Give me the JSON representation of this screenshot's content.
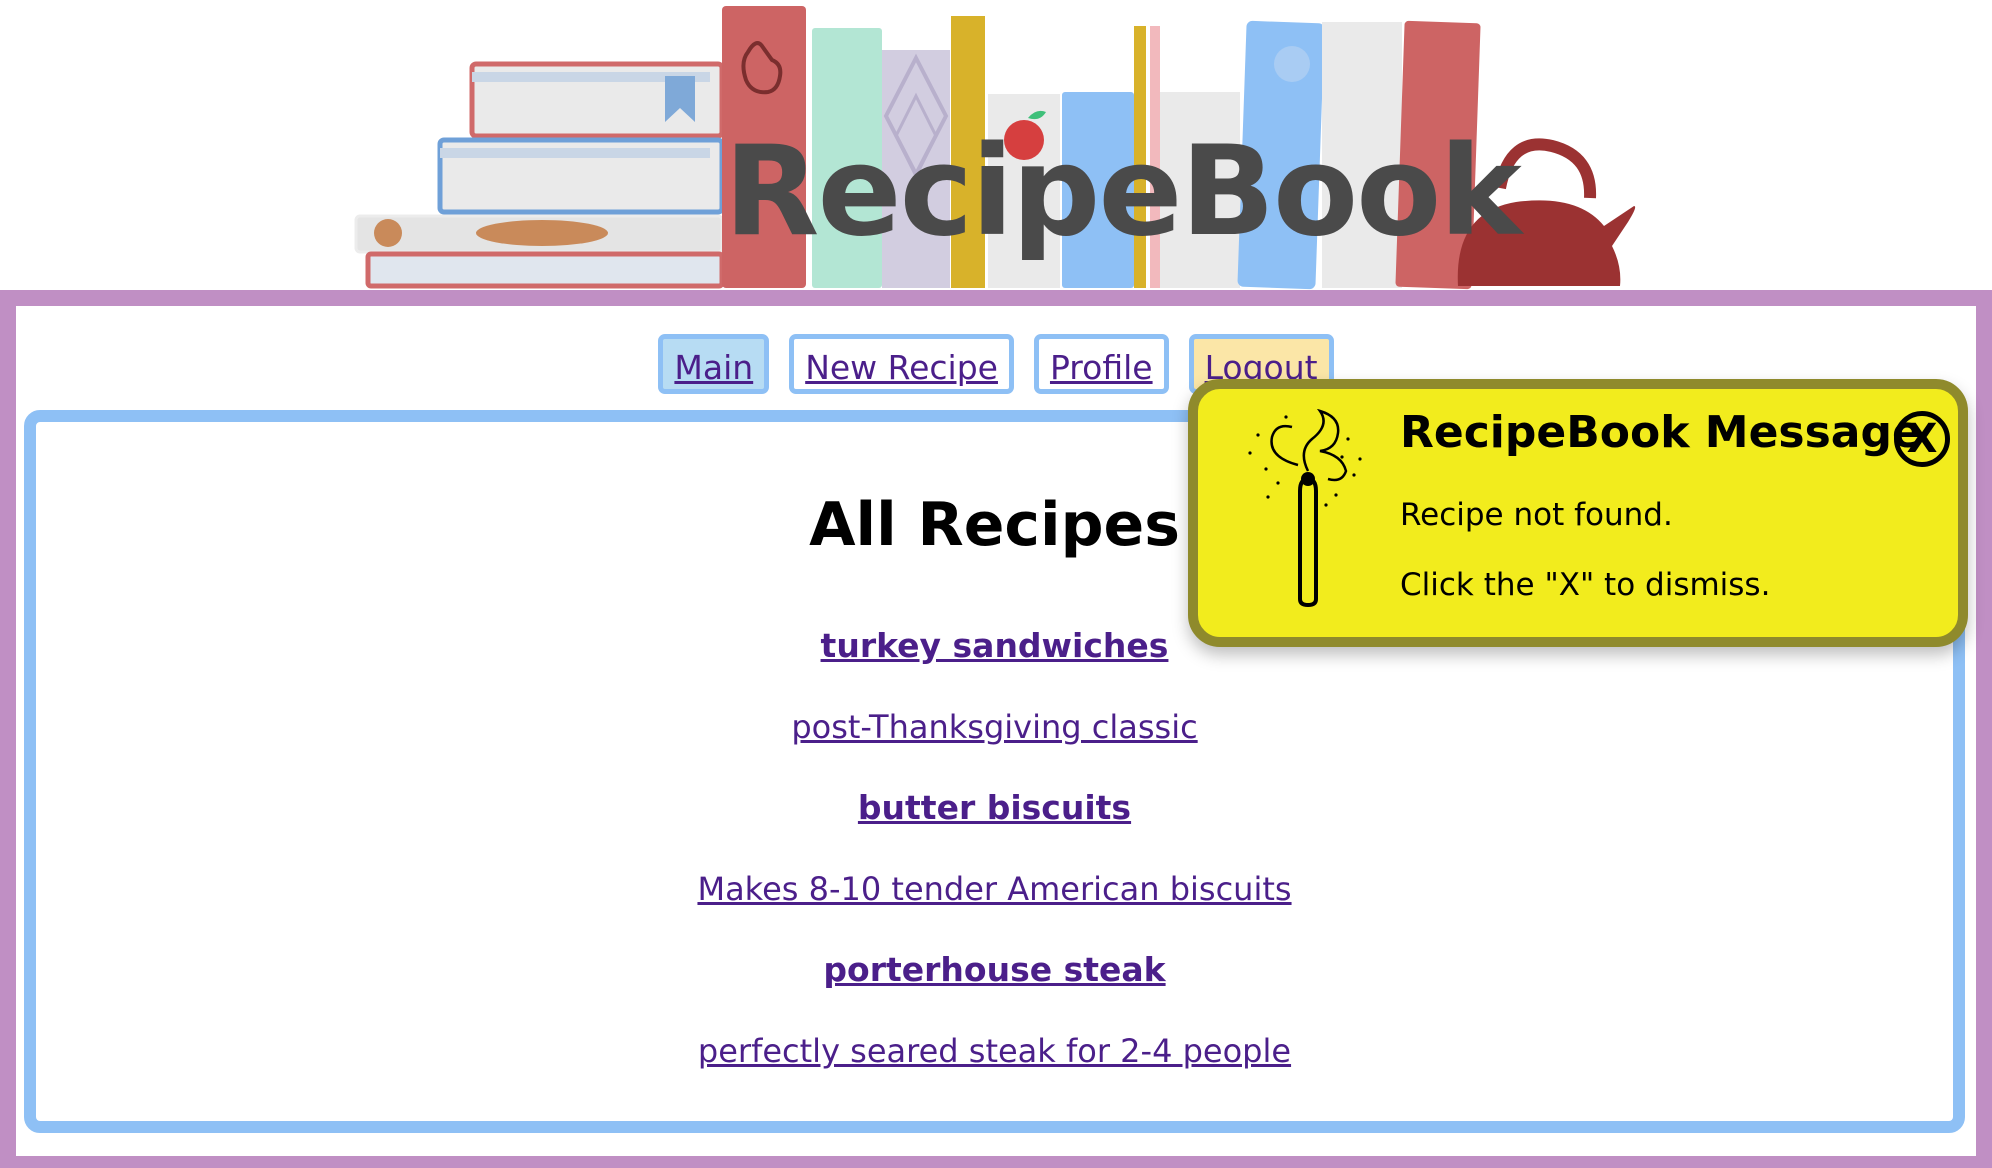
{
  "app": {
    "logo_text": "RecipeBook"
  },
  "nav": {
    "items": [
      {
        "label": "Main",
        "state": "active"
      },
      {
        "label": "New Recipe",
        "state": "normal"
      },
      {
        "label": "Profile",
        "state": "normal"
      },
      {
        "label": "Logout",
        "state": "highlight"
      }
    ]
  },
  "main": {
    "title": "All Recipes",
    "recipes": [
      {
        "name": "turkey sandwiches",
        "description": "post-Thanksgiving classic"
      },
      {
        "name": "butter biscuits",
        "description": "Makes 8-10 tender American biscuits"
      },
      {
        "name": "porterhouse steak",
        "description": "perfectly seared steak for 2-4 people"
      }
    ]
  },
  "message": {
    "title": "RecipeBook Message",
    "close_label": "X",
    "lines": [
      "Recipe not found.",
      "Click the \"X\" to dismiss."
    ],
    "icon": "burnt-match-icon"
  },
  "colors": {
    "frame": "#c08fc4",
    "panel_border": "#8ec0f5",
    "link": "#4b1f8a",
    "toast_bg": "#f2ec1d",
    "toast_border": "#8f8a2c",
    "nav_active_bg": "#b7dcf3",
    "nav_logout_bg": "#fbe6a7"
  }
}
